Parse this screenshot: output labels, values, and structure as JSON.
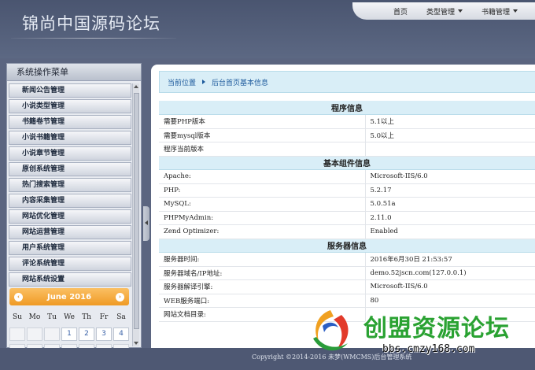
{
  "header": {
    "logo": "锦尚中国源码论坛",
    "nav": [
      {
        "label": "首页",
        "dropdown": false
      },
      {
        "label": "类型管理",
        "dropdown": true
      },
      {
        "label": "书籍管理",
        "dropdown": true
      }
    ]
  },
  "sidebar": {
    "title": "系统操作菜单",
    "items": [
      "新闻公告管理",
      "小说类型管理",
      "书籍卷节管理",
      "小说书籍管理",
      "小说章节管理",
      "原创系统管理",
      "热门搜索管理",
      "内容采集管理",
      "网站优化管理",
      "网站运营管理",
      "用户系统管理",
      "评论系统管理",
      "网站系统设置"
    ]
  },
  "calendar": {
    "month": "June 2016",
    "prev": "‹",
    "next": "›",
    "weekdays": [
      "Su",
      "Mo",
      "Tu",
      "We",
      "Th",
      "Fr",
      "Sa"
    ],
    "week1": [
      "",
      "",
      "",
      "1",
      "2",
      "3",
      "4"
    ]
  },
  "breadcrumb": {
    "location": "当前位置",
    "page": "后台首页基本信息"
  },
  "sections": [
    {
      "title": "程序信息",
      "rows": [
        {
          "label": "需要PHP版本",
          "value": "5.1以上"
        },
        {
          "label": "需要mysql版本",
          "value": "5.0以上"
        },
        {
          "label": "程序当前版本",
          "value": ""
        }
      ]
    },
    {
      "title": "基本组件信息",
      "rows": [
        {
          "label": "Apache:",
          "value": "Microsoft-IIS/6.0"
        },
        {
          "label": "PHP:",
          "value": "5.2.17"
        },
        {
          "label": "MySQL:",
          "value": "5.0.51a"
        },
        {
          "label": "PHPMyAdmin:",
          "value": "2.11.0"
        },
        {
          "label": "Zend Optimizer:",
          "value": "Enabled"
        }
      ]
    },
    {
      "title": "服务器信息",
      "rows": [
        {
          "label": "服务器时间:",
          "value": "2016年6月30日 21:53:57"
        },
        {
          "label": "服务器域名/IP地址:",
          "value": "demo.52jscn.com(127.0.0.1)"
        },
        {
          "label": "服务器解译引擎:",
          "value": "Microsoft-IIS/6.0"
        },
        {
          "label": "WEB服务端口:",
          "value": "80"
        },
        {
          "label": "网站文档目录:",
          "value": ""
        }
      ]
    }
  ],
  "footer": {
    "text": "Copyright ©2014-2016 未梦(WMCMS)后台管理系统"
  },
  "watermark": {
    "title": "创盟资源论坛",
    "url": "bbs.cmzy168.com"
  }
}
